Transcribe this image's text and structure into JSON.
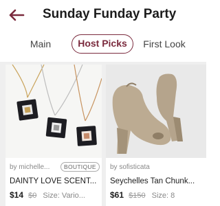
{
  "header": {
    "title": "Sunday Funday Party"
  },
  "tabs": [
    {
      "label": "Main"
    },
    {
      "label": "Host Picks"
    },
    {
      "label": "First Look"
    }
  ],
  "listings": [
    {
      "seller": "by michelle...",
      "badge": "BOUTIQUE",
      "title": "DAINTY LOVE SCENT...",
      "price": "$14",
      "original_price": "$0",
      "size": "Size: Vario..."
    },
    {
      "seller": "by sofisticata",
      "title": "Seychelles Tan Chunk...",
      "price": "$61",
      "original_price": "$150",
      "size": "Size: 8"
    }
  ],
  "colors": {
    "accent": "#7a2a3d",
    "grid_bg": "#efefef"
  }
}
